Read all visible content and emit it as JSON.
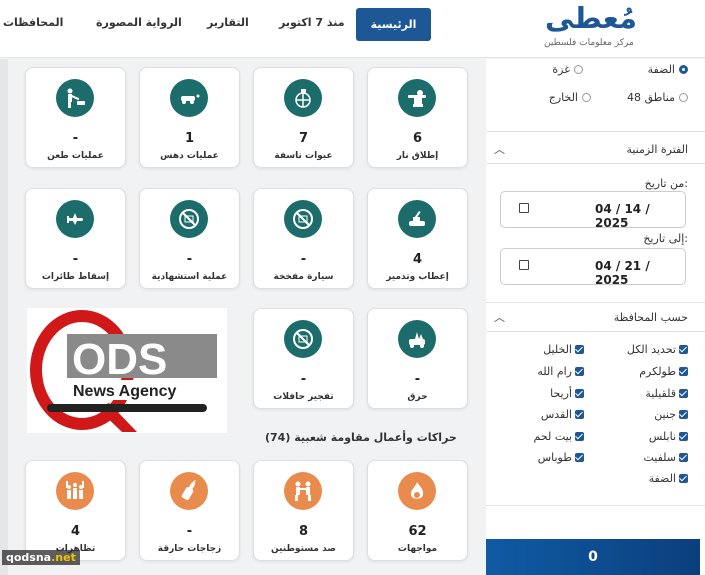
{
  "header": {
    "logo_word": "مُعطى",
    "logo_sub": "مركز معلومات فلسطين",
    "nav": [
      "الرئيسية",
      "منذ 7 اكتوبر",
      "التقارير",
      "الرواية المصورة",
      "المحافظات"
    ]
  },
  "sidebar": {
    "regions": [
      {
        "label": "الضفة",
        "selected": true
      },
      {
        "label": "غزة",
        "selected": false
      },
      {
        "label": "مناطق 48",
        "selected": false
      },
      {
        "label": "الخارج",
        "selected": false
      }
    ],
    "period_title": "الفترة الزمنية",
    "from_label": "من تاريخ:",
    "from_value": "04 / 14 / 2025",
    "to_label": "إلى تاريخ:",
    "to_value": "04 / 21 / 2025",
    "governorate_title": "حسب المحافظة",
    "governorates_right": [
      "تحديد الكل",
      "طولكرم",
      "قلقيلية",
      "جنين",
      "نابلس",
      "سلفيت",
      "الضفة"
    ],
    "governorates_left": [
      "الخليل",
      "رام الله",
      "أريحا",
      "القدس",
      "بيت لحم",
      "طوباس"
    ],
    "total_count": "0"
  },
  "resistance": {
    "cards_row1": [
      {
        "value": "6",
        "label": "إطلاق نار",
        "icon": "shooter-icon"
      },
      {
        "value": "7",
        "label": "عبوات ناسفة",
        "icon": "grenade-icon"
      },
      {
        "value": "1",
        "label": "عمليات دهس",
        "icon": "car-ramming-icon"
      },
      {
        "value": "-",
        "label": "عمليات طعن",
        "icon": "stabbing-icon"
      }
    ],
    "cards_row2": [
      {
        "value": "4",
        "label": "إعطاب وتدمير",
        "icon": "tank-icon"
      },
      {
        "value": "-",
        "label": "سيارة مفخخة",
        "icon": "prohibited-icon"
      },
      {
        "value": "-",
        "label": "عملية استشهادية",
        "icon": "prohibited-icon"
      },
      {
        "value": "-",
        "label": "إسقاط طائرات",
        "icon": "plane-icon"
      }
    ],
    "cards_row3": [
      {
        "value": "-",
        "label": "حرق",
        "icon": "burning-car-icon"
      },
      {
        "value": "-",
        "label": "تفجير حافلات",
        "icon": "prohibited-icon"
      }
    ]
  },
  "popular": {
    "heading": "حراكات وأعمال مقاومة شعبية (74)",
    "cards": [
      {
        "value": "62",
        "label": "مواجهات",
        "icon": "fire-icon"
      },
      {
        "value": "8",
        "label": "صد مستوطنين",
        "icon": "fight-icon"
      },
      {
        "value": "-",
        "label": "زجاجات حارقة",
        "icon": "molotov-icon"
      },
      {
        "value": "4",
        "label": "تظاهرات",
        "icon": "protest-icon"
      }
    ]
  },
  "ad": {
    "brand": "QODS",
    "tagline": "News Agency"
  },
  "watermark": {
    "part1": "qodsna",
    "part2": ".net"
  },
  "colors": {
    "primary": "#1d5796",
    "teal": "#1c6c6c",
    "orange": "#e98b4c"
  }
}
